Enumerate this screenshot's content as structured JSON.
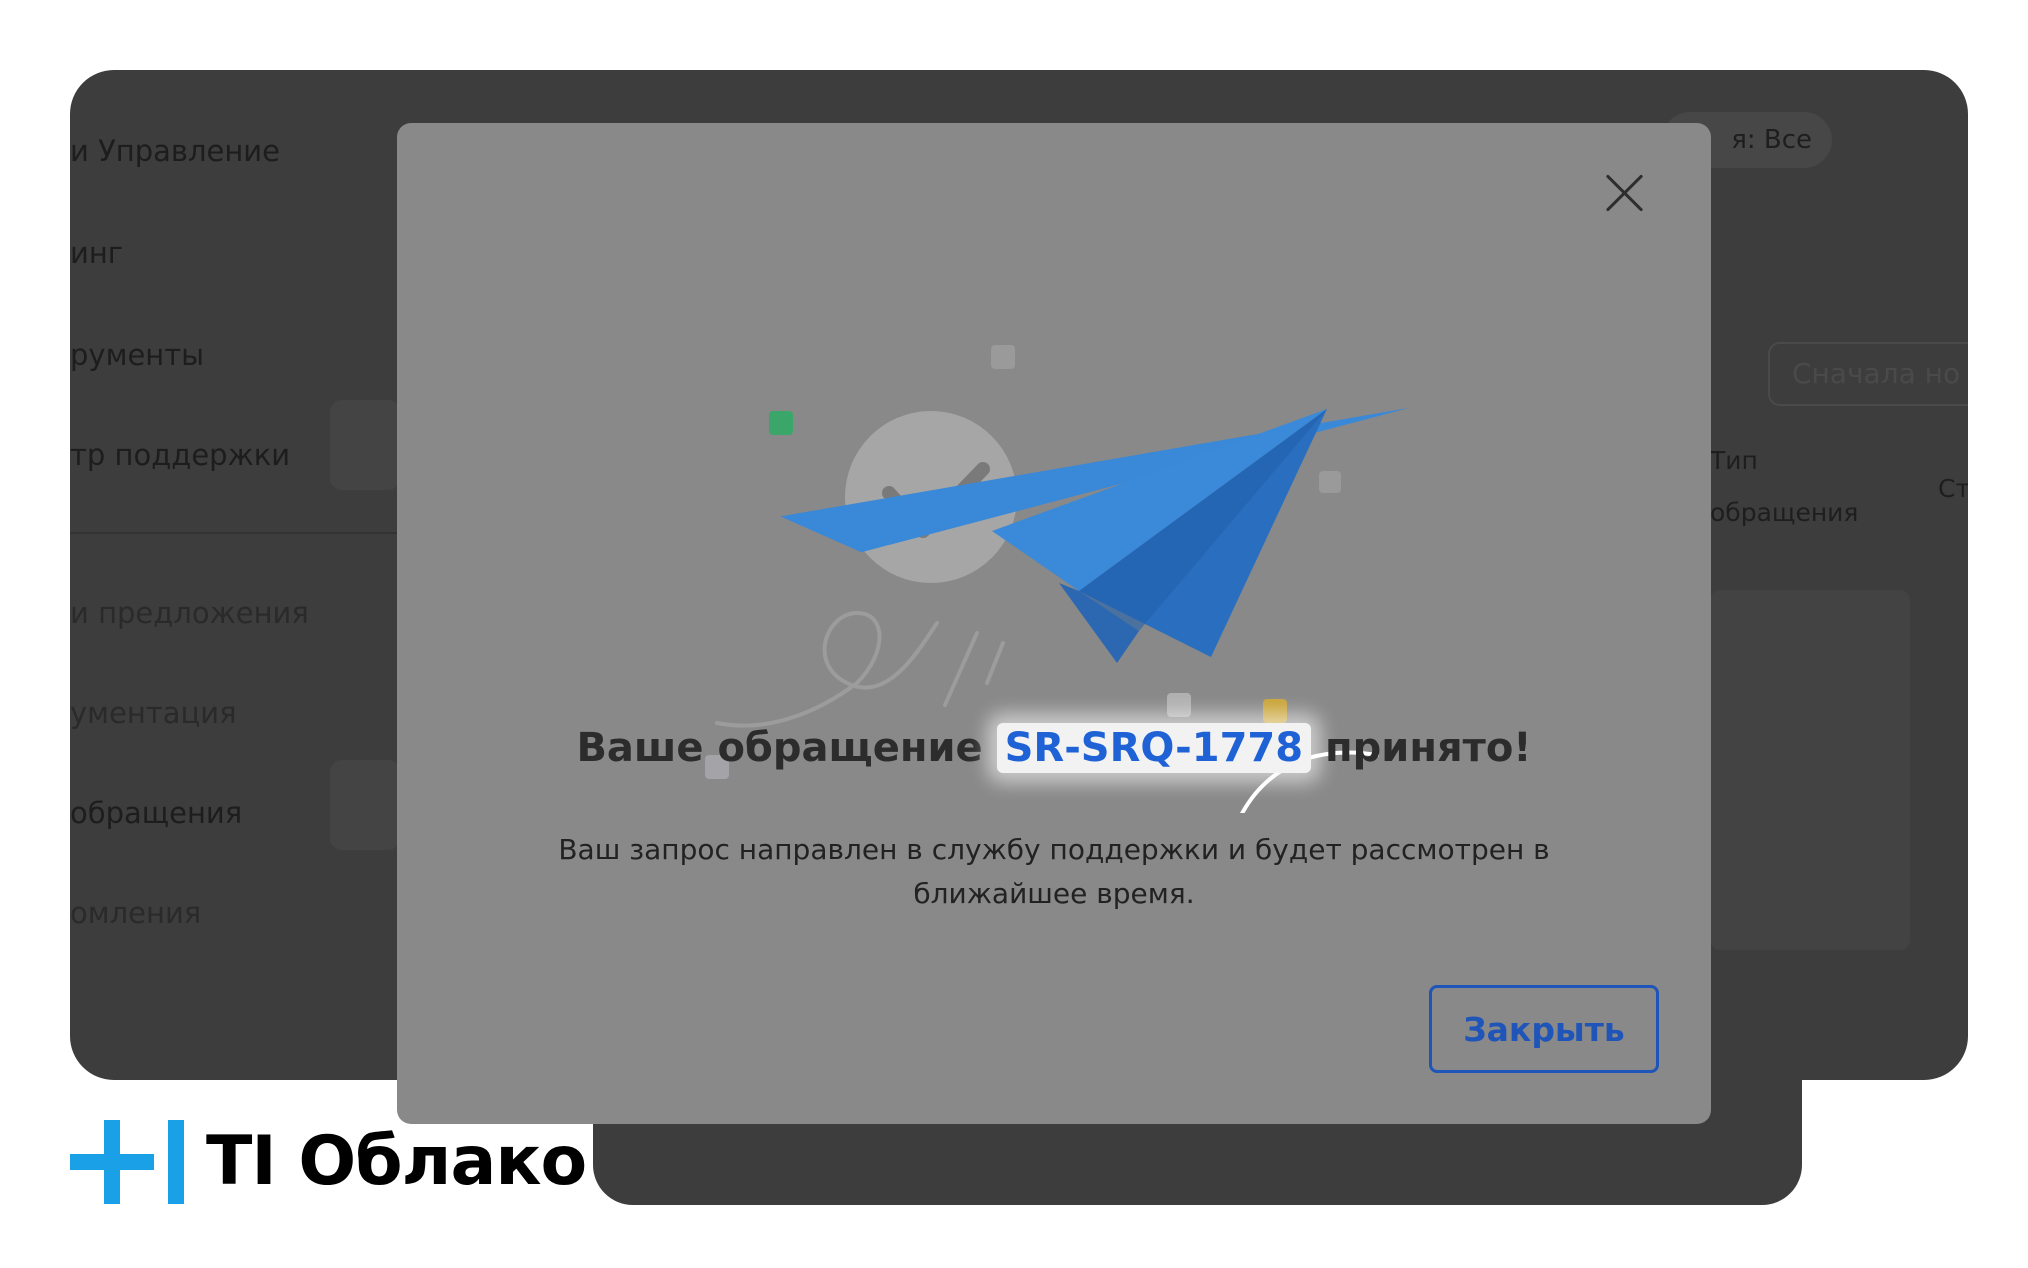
{
  "background": {
    "sidebar": {
      "items": [
        {
          "label": "и Управление"
        },
        {
          "label": "инг"
        },
        {
          "label": "рументы"
        },
        {
          "label": "тр поддержки"
        },
        {
          "label": "и предложения"
        },
        {
          "label": "ументация"
        },
        {
          "label": "обращения"
        },
        {
          "label": "омления"
        }
      ]
    },
    "filter_chip": "я: Все",
    "sort_select": "Сначала но",
    "columns": {
      "type_line1": "Тип",
      "type_line2": "обращения",
      "status": "Ст"
    }
  },
  "modal": {
    "title_before": "Ваше обращение",
    "ticket_id": "SR-SRQ-1778",
    "title_after": "принято!",
    "description": "Ваш запрос направлен в службу поддержки и будет рассмотрен в ближайшее время.",
    "close_button": "Закрыть",
    "close_icon": "close-icon",
    "illustration_icon": "paper-plane-icon"
  },
  "brand": {
    "name": "TI Облако",
    "accent_color": "#1aa0e6"
  },
  "colors": {
    "link_blue": "#1f62d6",
    "button_blue": "#1f55b8",
    "plane_blue": "#2f7bd0",
    "check_gray": "#a6a6a6"
  }
}
